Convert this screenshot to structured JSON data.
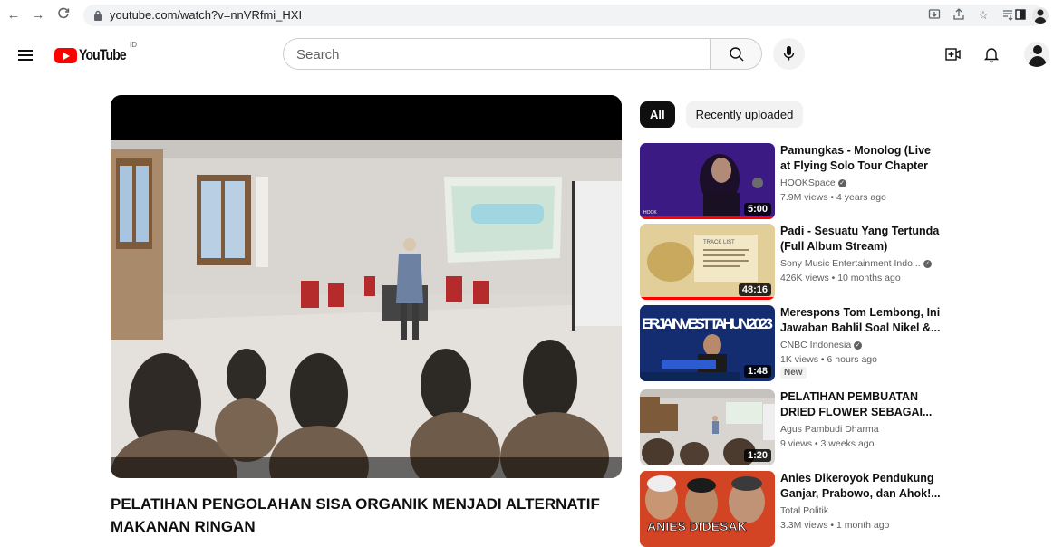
{
  "browser": {
    "url": "youtube.com/watch?v=nnVRfmi_HXI"
  },
  "header": {
    "logo_text": "YouTube",
    "country_code": "ID",
    "search_placeholder": "Search"
  },
  "video": {
    "title": "PELATIHAN PENGOLAHAN SISA ORGANIK MENJADI ALTERNATIF MAKANAN RINGAN"
  },
  "chips": [
    {
      "label": "All",
      "active": true
    },
    {
      "label": "Recently uploaded",
      "active": false
    }
  ],
  "recommendations": [
    {
      "title": "Pamungkas - Monolog (Live at Flying Solo Tour Chapter Jogja)",
      "channel": "HOOKSpace",
      "verified": true,
      "meta": "7.9M views • 4 years ago",
      "duration": "5:00",
      "thumb_text": "HOOK"
    },
    {
      "title": "Padi - Sesuatu Yang Tertunda (Full Album Stream)",
      "channel": "Sony Music Entertainment Indo...",
      "verified": true,
      "meta": "426K views • 10 months ago",
      "duration": "48:16",
      "thumb_text": "TRACK LIST"
    },
    {
      "title": "Merespons Tom Lembong, Ini Jawaban Bahlil Soal Nikel &...",
      "channel": "CNBC Indonesia",
      "verified": true,
      "meta": "1K views • 6 hours ago",
      "duration": "1:48",
      "badge": "New",
      "thumb_text": "ERJA INVEST TAHUN 2023"
    },
    {
      "title": "PELATIHAN PEMBUATAN DRIED FLOWER SEBAGAI...",
      "channel": "Agus Pambudi Dharma",
      "verified": false,
      "meta": "9 views • 3 weeks ago",
      "duration": "1:20"
    },
    {
      "title": "Anies Dikeroyok Pendukung Ganjar, Prabowo, dan Ahok!...",
      "channel": "Total Politik",
      "verified": false,
      "meta": "3.3M views • 1 month ago",
      "duration": "",
      "thumb_text": "ANIES DIDESAK"
    }
  ],
  "colors": {
    "brand_red": "#ff0000",
    "text_primary": "#0f0f0f",
    "text_secondary": "#606060"
  }
}
